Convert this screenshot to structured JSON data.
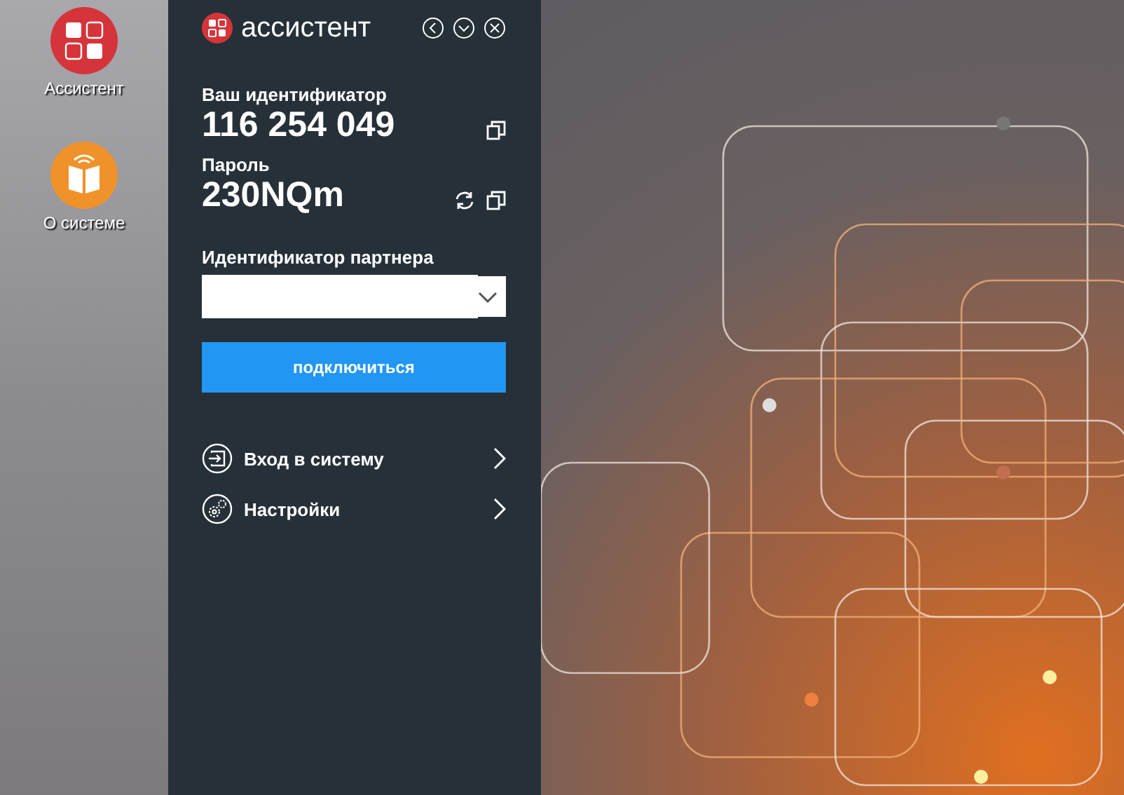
{
  "desktop_icons": [
    {
      "kind": "apps",
      "label": "Ассистент"
    },
    {
      "kind": "book",
      "label": "О системе"
    }
  ],
  "window": {
    "title": "ассистент"
  },
  "id_section": {
    "label": "Ваш идентификатор",
    "value": "116 254 049"
  },
  "password_section": {
    "label": "Пароль",
    "value": "230NQm"
  },
  "partner": {
    "label": "Идентификатор партнера"
  },
  "connect_button": "подключиться",
  "menu": [
    {
      "kind": "login",
      "label": "Вход в систему"
    },
    {
      "kind": "settings",
      "label": "Настройки"
    }
  ]
}
